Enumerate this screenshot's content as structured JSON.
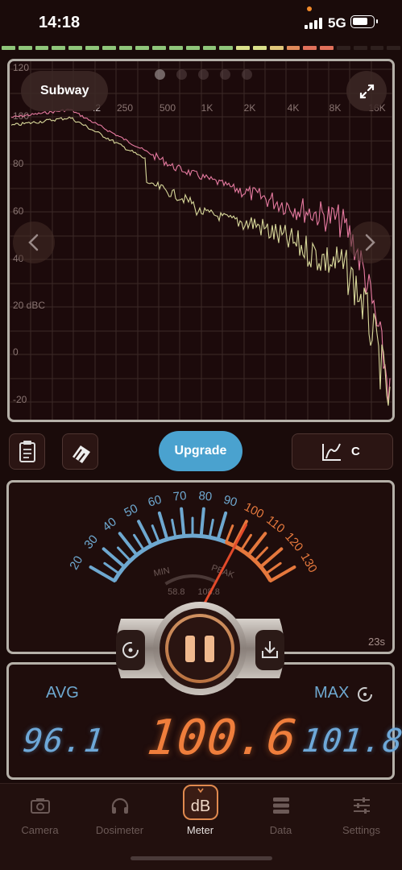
{
  "status_bar": {
    "time": "14:18",
    "network": "5G"
  },
  "level_strip": {
    "colors": [
      "#8fc67a",
      "#8fc67a",
      "#8fc67a",
      "#8fc67a",
      "#8fc67a",
      "#8fc67a",
      "#8fc67a",
      "#8fc67a",
      "#8fc67a",
      "#8fc67a",
      "#8fc67a",
      "#8fc67a",
      "#8fc67a",
      "#8fc67a",
      "#d9e08a",
      "#d9e08a",
      "#e0c77a",
      "#e08a5a",
      "#e0705a",
      "#e0705a",
      "#2e201e",
      "#2e201e",
      "#2e201e",
      "#2e201e"
    ]
  },
  "spectrum": {
    "preset_label": "Subway",
    "page_count": 5,
    "active_page": 0,
    "x_ticks": [
      "250",
      "500",
      "1K",
      "2K",
      "4K",
      "8K",
      "16K"
    ],
    "y_ticks": [
      "120",
      "100",
      "80",
      "60",
      "40",
      "20 dBC",
      "0",
      "-20"
    ],
    "hidden_tick_fragment": ".2",
    "colors": {
      "series_a": "#e67aa0",
      "series_b": "#d8d89a",
      "grid": "#3b2927"
    }
  },
  "toolbar": {
    "upgrade_label": "Upgrade",
    "weighting_label": "C"
  },
  "meter": {
    "scale_labels": [
      "20",
      "30",
      "40",
      "50",
      "60",
      "70",
      "80",
      "90",
      "100",
      "110",
      "120",
      "130"
    ],
    "min_label": "MIN",
    "peak_label": "PEAK",
    "min_value": "58.8",
    "peak_value": "108.8",
    "needle_value_db": 100.6,
    "elapsed": "23s"
  },
  "readouts": {
    "avg_label": "AVG",
    "max_label": "MAX",
    "avg_value": "96.1",
    "current_value": "100.6",
    "max_value": "101.8"
  },
  "tabs": [
    {
      "label": "Camera",
      "icon": "camera-icon",
      "active": false
    },
    {
      "label": "Dosimeter",
      "icon": "headphones-icon",
      "active": false
    },
    {
      "label": "Meter",
      "icon": "db-meter-icon",
      "active": true
    },
    {
      "label": "Data",
      "icon": "database-icon",
      "active": false
    },
    {
      "label": "Settings",
      "icon": "sliders-icon",
      "active": false
    }
  ]
}
